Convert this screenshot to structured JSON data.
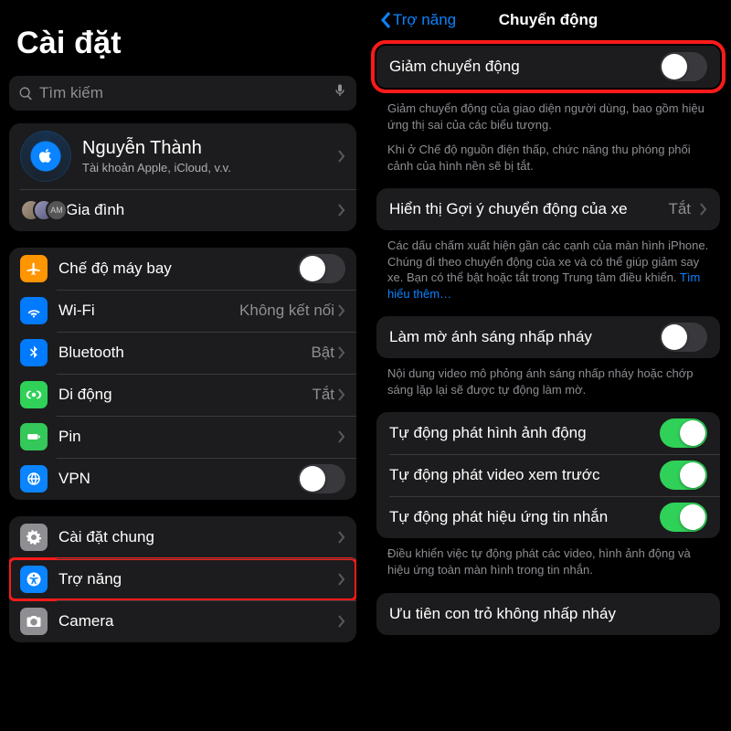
{
  "left": {
    "title": "Cài đặt",
    "search_placeholder": "Tìm kiếm",
    "apple_id": {
      "name": "Nguyễn Thành",
      "subtitle": "Tài khoản Apple, iCloud, v.v."
    },
    "family_label": "Gia đình",
    "family_badge": "AM",
    "items": [
      {
        "icon": "airplane",
        "label": "Chế độ máy bay",
        "type": "switch",
        "on": false
      },
      {
        "icon": "wifi",
        "label": "Wi-Fi",
        "type": "value",
        "value": "Không kết nối"
      },
      {
        "icon": "bt",
        "label": "Bluetooth",
        "type": "value",
        "value": "Bật"
      },
      {
        "icon": "cell",
        "label": "Di động",
        "type": "value",
        "value": "Tắt"
      },
      {
        "icon": "batt",
        "label": "Pin",
        "type": "nav"
      },
      {
        "icon": "vpn",
        "label": "VPN",
        "type": "switch",
        "on": false
      }
    ],
    "items2": [
      {
        "icon": "gear",
        "label": "Cài đặt chung",
        "type": "nav"
      },
      {
        "icon": "access",
        "label": "Trợ năng",
        "type": "nav",
        "highlight": true
      },
      {
        "icon": "camera",
        "label": "Camera",
        "type": "nav"
      }
    ]
  },
  "right": {
    "back_label": "Trợ năng",
    "title": "Chuyển động",
    "reduce_motion": {
      "label": "Giảm chuyển động",
      "on": false,
      "desc1": "Giảm chuyển động của giao diện người dùng, bao gồm hiệu ứng thị sai của các biểu tượng.",
      "desc2": "Khi ở Chế độ nguồn điện thấp, chức năng thu phóng phối cảnh của hình nền sẽ bị tắt."
    },
    "vehicle_cues": {
      "label": "Hiển thị Gợi ý chuyển động của xe",
      "value": "Tắt",
      "desc": "Các dấu chấm xuất hiện gần các cạnh của màn hình iPhone. Chúng đi theo chuyển động của xe và có thể giúp giảm say xe. Bạn có thể bật hoặc tắt trong Trung tâm điều khiển. ",
      "learn_more": "Tìm hiểu thêm…"
    },
    "dim_flash": {
      "label": "Làm mờ ánh sáng nhấp nháy",
      "on": false,
      "desc": "Nội dung video mô phỏng ánh sáng nhấp nháy hoặc chớp sáng lặp lại sẽ được tự động làm mờ."
    },
    "autoplay": [
      {
        "label": "Tự động phát hình ảnh động",
        "on": true
      },
      {
        "label": "Tự động phát video xem trước",
        "on": true
      },
      {
        "label": "Tự động phát hiệu ứng tin nhắn",
        "on": true
      }
    ],
    "autoplay_desc": "Điều khiển việc tự động phát các video, hình ảnh động và hiệu ứng toàn màn hình trong tin nhắn.",
    "crossfade": {
      "label": "Ưu tiên con trỏ không nhấp nháy"
    }
  }
}
